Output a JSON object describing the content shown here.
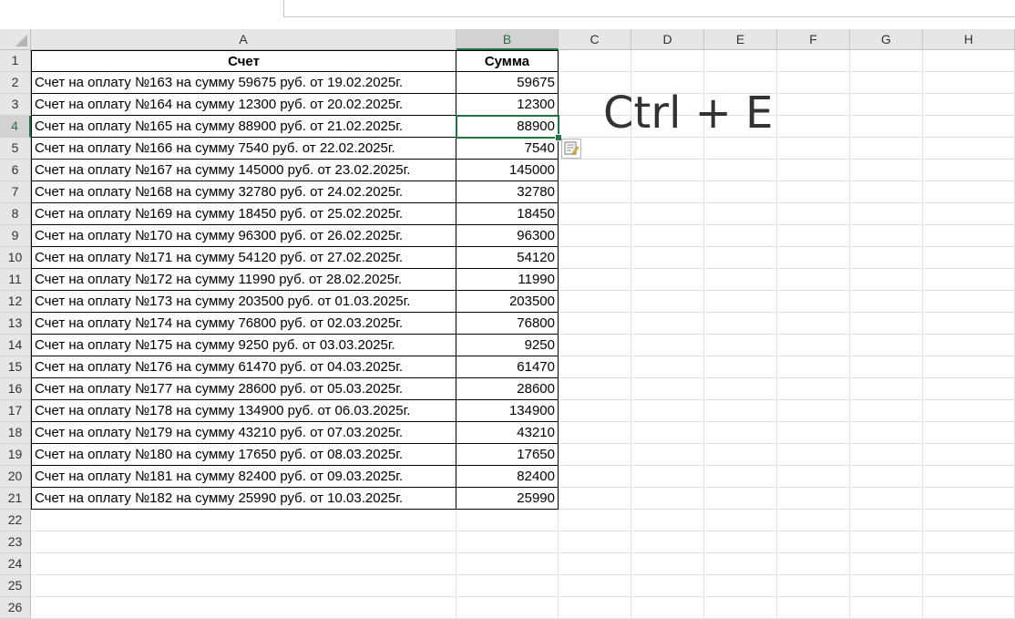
{
  "columns": [
    "A",
    "B",
    "C",
    "D",
    "E",
    "F",
    "G",
    "H"
  ],
  "selected_column": "B",
  "selected_row": "4",
  "header_row": {
    "row": "1",
    "a": "Счет",
    "b": "Сумма"
  },
  "rows": [
    {
      "row": "2",
      "a": "Счет на оплату №163 на сумму 59675 руб. от 19.02.2025г.",
      "b": "59675"
    },
    {
      "row": "3",
      "a": "Счет на оплату №164 на сумму 12300 руб. от 20.02.2025г.",
      "b": "12300"
    },
    {
      "row": "4",
      "a": "Счет на оплату №165 на сумму 88900 руб. от 21.02.2025г.",
      "b": "88900"
    },
    {
      "row": "5",
      "a": "Счет на оплату №166 на сумму 7540 руб. от 22.02.2025г.",
      "b": "7540"
    },
    {
      "row": "6",
      "a": "Счет на оплату №167 на сумму 145000 руб. от 23.02.2025г.",
      "b": "145000"
    },
    {
      "row": "7",
      "a": "Счет на оплату №168 на сумму 32780 руб. от 24.02.2025г.",
      "b": "32780"
    },
    {
      "row": "8",
      "a": "Счет на оплату №169 на сумму 18450 руб. от 25.02.2025г.",
      "b": "18450"
    },
    {
      "row": "9",
      "a": "Счет на оплату №170 на сумму 96300 руб. от 26.02.2025г.",
      "b": "96300"
    },
    {
      "row": "10",
      "a": "Счет на оплату №171 на сумму 54120 руб. от 27.02.2025г.",
      "b": "54120"
    },
    {
      "row": "11",
      "a": "Счет на оплату №172 на сумму 11990 руб. от 28.02.2025г.",
      "b": "11990"
    },
    {
      "row": "12",
      "a": "Счет на оплату №173 на сумму 203500 руб. от 01.03.2025г.",
      "b": "203500"
    },
    {
      "row": "13",
      "a": "Счет на оплату №174 на сумму 76800 руб. от 02.03.2025г.",
      "b": "76800"
    },
    {
      "row": "14",
      "a": "Счет на оплату №175 на сумму 9250 руб. от 03.03.2025г.",
      "b": "9250"
    },
    {
      "row": "15",
      "a": "Счет на оплату №176 на сумму 61470 руб. от 04.03.2025г.",
      "b": "61470"
    },
    {
      "row": "16",
      "a": "Счет на оплату №177 на сумму 28600 руб. от 05.03.2025г.",
      "b": "28600"
    },
    {
      "row": "17",
      "a": "Счет на оплату №178 на сумму 134900 руб. от 06.03.2025г.",
      "b": "134900"
    },
    {
      "row": "18",
      "a": "Счет на оплату №179 на сумму 43210 руб. от 07.03.2025г.",
      "b": "43210"
    },
    {
      "row": "19",
      "a": "Счет на оплату №180 на сумму 17650 руб. от 08.03.2025г.",
      "b": "17650"
    },
    {
      "row": "20",
      "a": "Счет на оплату №181 на сумму 82400 руб. от 09.03.2025г.",
      "b": "82400"
    },
    {
      "row": "21",
      "a": "Счет на оплату №182 на сумму 25990 руб. от 10.03.2025г.",
      "b": "25990"
    }
  ],
  "empty_rows": [
    "22",
    "23",
    "24",
    "25",
    "26"
  ],
  "overlay_text": "Ctrl + E",
  "flash_fill_icon": "flash-fill-options-icon",
  "colors": {
    "accent": "#217346",
    "header_bg": "#e6e6e6",
    "grid": "#e1e1e1"
  }
}
